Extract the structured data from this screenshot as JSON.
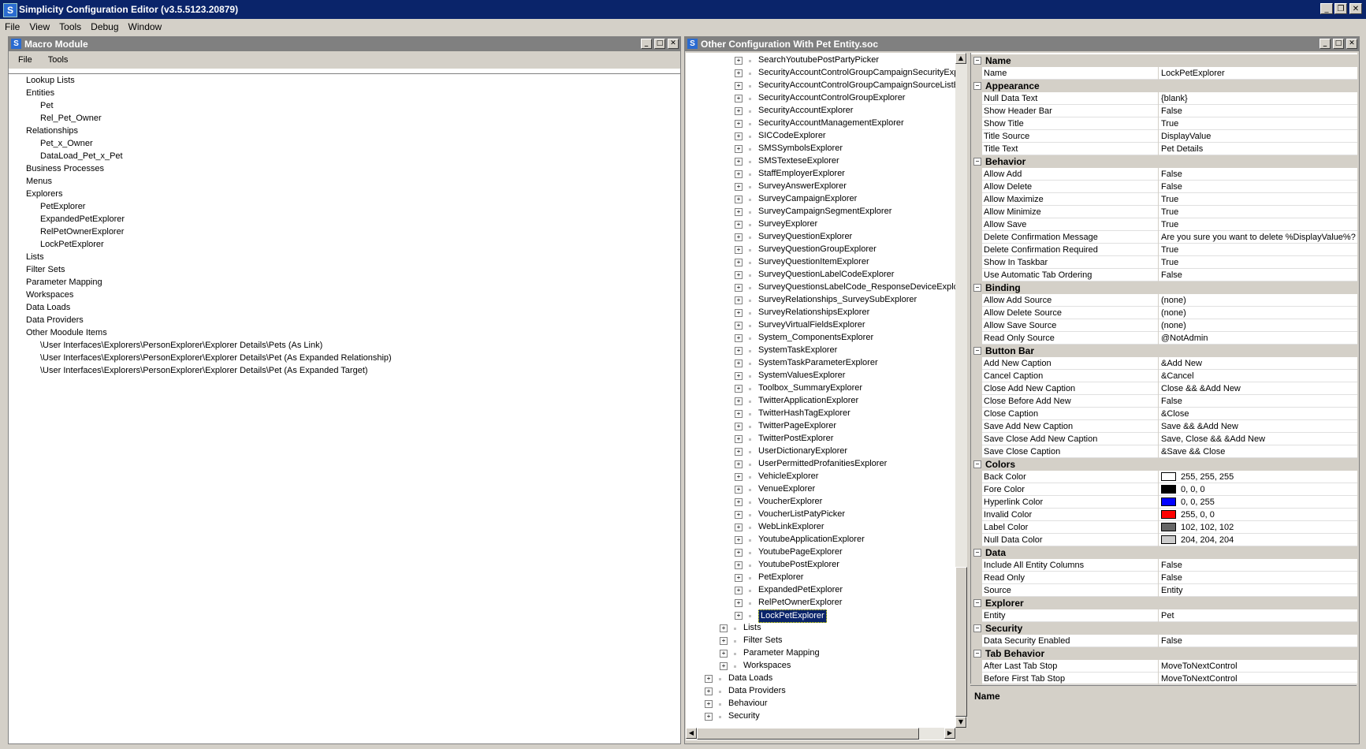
{
  "app": {
    "title": "Simplicity Configuration Editor (v3.5.5123.20879)",
    "menu": [
      "File",
      "View",
      "Tools",
      "Debug",
      "Window"
    ]
  },
  "macro_module": {
    "title": "Macro Module",
    "menu": [
      "File",
      "Tools"
    ],
    "items": [
      {
        "label": "Lookup Lists",
        "level": 0
      },
      {
        "label": "Entities",
        "level": 0
      },
      {
        "label": "Pet",
        "level": 1
      },
      {
        "label": "Rel_Pet_Owner",
        "level": 1
      },
      {
        "label": "Relationships",
        "level": 0
      },
      {
        "label": "Pet_x_Owner",
        "level": 1
      },
      {
        "label": "DataLoad_Pet_x_Pet",
        "level": 1
      },
      {
        "label": "Business Processes",
        "level": 0
      },
      {
        "label": "Menus",
        "level": 0
      },
      {
        "label": "Explorers",
        "level": 0
      },
      {
        "label": "PetExplorer",
        "level": 1
      },
      {
        "label": "ExpandedPetExplorer",
        "level": 1
      },
      {
        "label": "RelPetOwnerExplorer",
        "level": 1
      },
      {
        "label": "LockPetExplorer",
        "level": 1
      },
      {
        "label": "Lists",
        "level": 0
      },
      {
        "label": "Filter Sets",
        "level": 0
      },
      {
        "label": "Parameter Mapping",
        "level": 0
      },
      {
        "label": "Workspaces",
        "level": 0
      },
      {
        "label": "Data Loads",
        "level": 0
      },
      {
        "label": "Data Providers",
        "level": 0
      },
      {
        "label": "Other Moodule Items",
        "level": 0
      },
      {
        "label": "\\User Interfaces\\Explorers\\PersonExplorer\\Explorer Details\\Pets (As Link)",
        "level": 1
      },
      {
        "label": "\\User Interfaces\\Explorers\\PersonExplorer\\Explorer Details\\Pet (As Expanded Relationship)",
        "level": 1
      },
      {
        "label": "\\User Interfaces\\Explorers\\PersonExplorer\\Explorer Details\\Pet (As Expanded Target)",
        "level": 1
      }
    ]
  },
  "config": {
    "title": "Other Configuration With Pet Entity.soc",
    "tree": [
      {
        "label": "SearchYoutubePostPartyPicker",
        "level": 3
      },
      {
        "label": "SecurityAccountControlGroupCampaignSecurityExp",
        "level": 3
      },
      {
        "label": "SecurityAccountControlGroupCampaignSourceListE",
        "level": 3
      },
      {
        "label": "SecurityAccountControlGroupExplorer",
        "level": 3
      },
      {
        "label": "SecurityAccountExplorer",
        "level": 3
      },
      {
        "label": "SecurityAccountManagementExplorer",
        "level": 3
      },
      {
        "label": "SICCodeExplorer",
        "level": 3
      },
      {
        "label": "SMSSymbolsExplorer",
        "level": 3
      },
      {
        "label": "SMSTexteseExplorer",
        "level": 3
      },
      {
        "label": "StaffEmployerExplorer",
        "level": 3
      },
      {
        "label": "SurveyAnswerExplorer",
        "level": 3
      },
      {
        "label": "SurveyCampaignExplorer",
        "level": 3
      },
      {
        "label": "SurveyCampaignSegmentExplorer",
        "level": 3
      },
      {
        "label": "SurveyExplorer",
        "level": 3
      },
      {
        "label": "SurveyQuestionExplorer",
        "level": 3
      },
      {
        "label": "SurveyQuestionGroupExplorer",
        "level": 3
      },
      {
        "label": "SurveyQuestionItemExplorer",
        "level": 3
      },
      {
        "label": "SurveyQuestionLabelCodeExplorer",
        "level": 3
      },
      {
        "label": "SurveyQuestionsLabelCode_ResponseDeviceExplo",
        "level": 3
      },
      {
        "label": "SurveyRelationships_SurveySubExplorer",
        "level": 3
      },
      {
        "label": "SurveyRelationshipsExplorer",
        "level": 3
      },
      {
        "label": "SurveyVirtualFieldsExplorer",
        "level": 3
      },
      {
        "label": "System_ComponentsExplorer",
        "level": 3
      },
      {
        "label": "SystemTaskExplorer",
        "level": 3
      },
      {
        "label": "SystemTaskParameterExplorer",
        "level": 3
      },
      {
        "label": "SystemValuesExplorer",
        "level": 3
      },
      {
        "label": "Toolbox_SummaryExplorer",
        "level": 3
      },
      {
        "label": "TwitterApplicationExplorer",
        "level": 3
      },
      {
        "label": "TwitterHashTagExplorer",
        "level": 3
      },
      {
        "label": "TwitterPageExplorer",
        "level": 3
      },
      {
        "label": "TwitterPostExplorer",
        "level": 3
      },
      {
        "label": "UserDictionaryExplorer",
        "level": 3
      },
      {
        "label": "UserPermittedProfanitiesExplorer",
        "level": 3
      },
      {
        "label": "VehicleExplorer",
        "level": 3
      },
      {
        "label": "VenueExplorer",
        "level": 3
      },
      {
        "label": "VoucherExplorer",
        "level": 3
      },
      {
        "label": "VoucherListPatyPicker",
        "level": 3
      },
      {
        "label": "WebLinkExplorer",
        "level": 3
      },
      {
        "label": "YoutubeApplicationExplorer",
        "level": 3
      },
      {
        "label": "YoutubePageExplorer",
        "level": 3
      },
      {
        "label": "YoutubePostExplorer",
        "level": 3
      },
      {
        "label": "PetExplorer",
        "level": 3
      },
      {
        "label": "ExpandedPetExplorer",
        "level": 3
      },
      {
        "label": "RelPetOwnerExplorer",
        "level": 3
      },
      {
        "label": "LockPetExplorer",
        "level": 3,
        "selected": true
      },
      {
        "label": "Lists",
        "level": 2
      },
      {
        "label": "Filter Sets",
        "level": 2
      },
      {
        "label": "Parameter Mapping",
        "level": 2
      },
      {
        "label": "Workspaces",
        "level": 2
      },
      {
        "label": "Data Loads",
        "level": 1
      },
      {
        "label": "Data Providers",
        "level": 1
      },
      {
        "label": "Behaviour",
        "level": 1
      },
      {
        "label": "Security",
        "level": 1
      }
    ]
  },
  "properties": {
    "rows": [
      {
        "cat": "Name"
      },
      {
        "name": "Name",
        "value": "LockPetExplorer"
      },
      {
        "cat": "Appearance"
      },
      {
        "name": "Null Data Text",
        "value": "{blank}"
      },
      {
        "name": "Show Header Bar",
        "value": "False"
      },
      {
        "name": "Show Title",
        "value": "True"
      },
      {
        "name": "Title Source",
        "value": "DisplayValue"
      },
      {
        "name": "Title Text",
        "value": "Pet Details"
      },
      {
        "cat": "Behavior"
      },
      {
        "name": "Allow Add",
        "value": "False"
      },
      {
        "name": "Allow Delete",
        "value": "False"
      },
      {
        "name": "Allow Maximize",
        "value": "True"
      },
      {
        "name": "Allow Minimize",
        "value": "True"
      },
      {
        "name": "Allow Save",
        "value": "True"
      },
      {
        "name": "Delete Confirmation Message",
        "value": "Are you sure you want to delete %DisplayValue%?"
      },
      {
        "name": "Delete Confirmation Required",
        "value": "True"
      },
      {
        "name": "Show In Taskbar",
        "value": "True"
      },
      {
        "name": "Use Automatic Tab Ordering",
        "value": "False"
      },
      {
        "cat": "Binding"
      },
      {
        "name": "Allow Add Source",
        "value": "(none)"
      },
      {
        "name": "Allow Delete Source",
        "value": "(none)"
      },
      {
        "name": "Allow Save Source",
        "value": "(none)"
      },
      {
        "name": "Read Only Source",
        "value": "@NotAdmin"
      },
      {
        "cat": "Button Bar"
      },
      {
        "name": "Add New Caption",
        "value": "&Add New"
      },
      {
        "name": "Cancel Caption",
        "value": "&Cancel"
      },
      {
        "name": "Close Add New Caption",
        "value": "Close && &Add New"
      },
      {
        "name": "Close Before Add New",
        "value": "False"
      },
      {
        "name": "Close Caption",
        "value": "&Close"
      },
      {
        "name": "Save Add New Caption",
        "value": "Save && &Add New"
      },
      {
        "name": "Save Close Add New Caption",
        "value": "Save, Close && &Add New"
      },
      {
        "name": "Save Close Caption",
        "value": "&Save && Close"
      },
      {
        "cat": "Colors"
      },
      {
        "name": "Back Color",
        "value": "255, 255, 255",
        "swatch": "#ffffff"
      },
      {
        "name": "Fore Color",
        "value": "0, 0, 0",
        "swatch": "#000000"
      },
      {
        "name": "Hyperlink Color",
        "value": "0, 0, 255",
        "swatch": "#0000ff"
      },
      {
        "name": "Invalid Color",
        "value": "255, 0, 0",
        "swatch": "#ff0000"
      },
      {
        "name": "Label Color",
        "value": "102, 102, 102",
        "swatch": "#666666"
      },
      {
        "name": "Null Data Color",
        "value": "204, 204, 204",
        "swatch": "#cccccc"
      },
      {
        "cat": "Data"
      },
      {
        "name": "Include All Entity Columns",
        "value": "False"
      },
      {
        "name": "Read Only",
        "value": "False"
      },
      {
        "name": "Source",
        "value": "Entity"
      },
      {
        "cat": "Explorer"
      },
      {
        "name": "Entity",
        "value": "Pet"
      },
      {
        "cat": "Security"
      },
      {
        "name": "Data Security Enabled",
        "value": "False"
      },
      {
        "cat": "Tab Behavior"
      },
      {
        "name": "After Last Tab Stop",
        "value": "MoveToNextControl"
      },
      {
        "name": "Before First Tab Stop",
        "value": "MoveToNextControl"
      }
    ],
    "description_title": "Name"
  },
  "icons": {
    "minimize": "minimize-icon",
    "maximize": "maximize-icon",
    "close": "close-icon",
    "expand": "plus-icon",
    "collapse": "minus-icon"
  },
  "colors": {
    "titlebar": "#0a246a",
    "pane_titlebar": "#808080",
    "selection": "#0a246a"
  }
}
